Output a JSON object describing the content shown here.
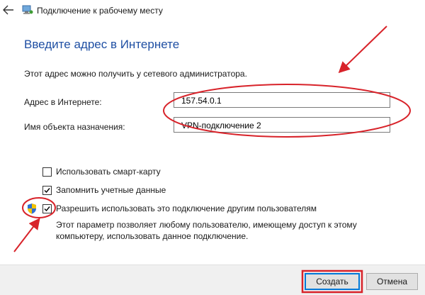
{
  "window": {
    "title": "Подключение к рабочему месту",
    "back_icon": "arrow-left-icon",
    "app_icon": "network-icon"
  },
  "main": {
    "heading": "Введите адрес в Интернете",
    "description": "Этот адрес можно получить у сетевого администратора."
  },
  "fields": {
    "address": {
      "label": "Адрес в Интернете:",
      "value": "157.54.0.1"
    },
    "destination": {
      "label": "Имя объекта назначения:",
      "value": "VPN-подключение 2"
    }
  },
  "options": {
    "smart_card": {
      "label": "Использовать смарт-карту",
      "checked": false
    },
    "remember": {
      "label": "Запомнить учетные данные",
      "checked": true
    },
    "allow_others": {
      "label": "Разрешить использовать это подключение другим пользователям",
      "checked": true,
      "icon": "uac-shield-icon"
    },
    "note_line1": "Этот параметр позволяет любому пользователю, имеющему доступ к этому",
    "note_line2": "компьютеру, использовать данное подключение."
  },
  "footer": {
    "create_label": "Создать",
    "cancel_label": "Отмена"
  },
  "colors": {
    "heading": "#1f4fa3",
    "annotation": "#d8232a",
    "focus_border": "#0078d7"
  }
}
